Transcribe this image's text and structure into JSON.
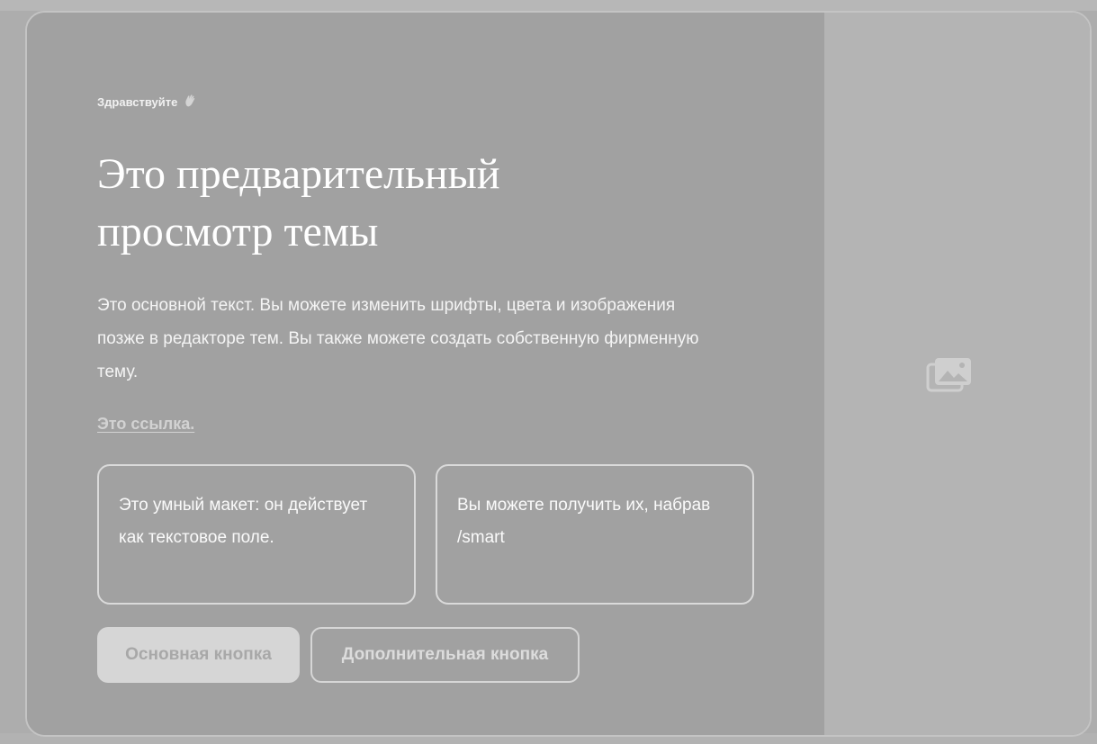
{
  "preview": {
    "greeting": "Здравствуйте",
    "greeting_icon": "waving-hand-icon",
    "title": "Это предварительный просмотр темы",
    "body": "Это основной текст. Вы можете изменить шрифты, цвета и изображения позже в редакторе тем. Вы также можете создать собственную фирменную тему.",
    "link_label": "Это ссылка.",
    "smart_layout": [
      {
        "text": "Это умный макет: он действует как текстовое поле."
      },
      {
        "text": "Вы можете получить их, набрав /smart"
      }
    ],
    "primary_button_label": "Основная кнопка",
    "secondary_button_label": "Дополнительная кнопка",
    "image_placeholder_icon": "image-placeholder-icon"
  },
  "colors": {
    "panel_background": "#a1a1a1",
    "image_panel_background": "#b4b4b4",
    "primary_button_background": "#d6d6d6",
    "text": "#ffffff"
  }
}
